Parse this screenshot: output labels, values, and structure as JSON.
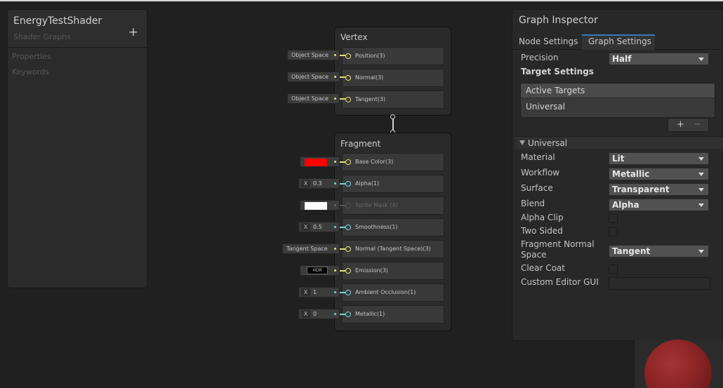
{
  "blackboard": {
    "title": "EnergyTestShader",
    "subtitle": "Shader Graphs",
    "add_icon": "+",
    "sections": [
      "Properties",
      "Keywords"
    ]
  },
  "vertex_node": {
    "title": "Vertex",
    "slots": [
      {
        "label": "Position(3)",
        "input": "Object Space"
      },
      {
        "label": "Normal(3)",
        "input": "Object Space"
      },
      {
        "label": "Tangent(3)",
        "input": "Object Space"
      }
    ]
  },
  "fragment_node": {
    "title": "Fragment",
    "slots": [
      {
        "label": "Base Color(3)",
        "input_type": "color",
        "input_color": "#ff0000"
      },
      {
        "label": "Alpha(1)",
        "input_type": "x",
        "x_label": "X",
        "value": "0.3"
      },
      {
        "label": "Sprite Mask (4)",
        "input_type": "color",
        "input_color": "#ffffff"
      },
      {
        "label": "Smoothness(1)",
        "input_type": "x",
        "x_label": "X",
        "value": "0.5"
      },
      {
        "label": "Normal (Tangent Space)(3)",
        "input_type": "text",
        "input": "Tangent Space"
      },
      {
        "label": "Emission(3)",
        "input_type": "hdr",
        "input": "HDR"
      },
      {
        "label": "Ambient Occlusion(1)",
        "input_type": "x",
        "x_label": "X",
        "value": "1"
      },
      {
        "label": "Metallic(1)",
        "input_type": "x",
        "x_label": "X",
        "value": "0"
      }
    ]
  },
  "inspector": {
    "title": "Graph Inspector",
    "tabs": [
      "Node Settings",
      "Graph Settings"
    ],
    "active_tab": "Graph Settings",
    "precision_label": "Precision",
    "precision_value": "Half",
    "target_settings_label": "Target Settings",
    "active_targets_header": "Active Targets",
    "active_targets": [
      "Universal"
    ],
    "add_icon": "+",
    "remove_icon": "−",
    "section": "Universal",
    "settings": {
      "material": {
        "label": "Material",
        "value": "Lit"
      },
      "workflow": {
        "label": "Workflow",
        "value": "Metallic"
      },
      "surface": {
        "label": "Surface",
        "value": "Transparent"
      },
      "blend": {
        "label": "Blend",
        "value": "Alpha"
      },
      "alpha_clip": {
        "label": "Alpha Clip",
        "checked": false
      },
      "two_sided": {
        "label": "Two Sided",
        "checked": false
      },
      "fragment_normal_space": {
        "label": "Fragment Normal Space",
        "value": "Tangent"
      },
      "clear_coat": {
        "label": "Clear Coat",
        "checked": false
      },
      "custom_editor_gui": {
        "label": "Custom Editor GUI",
        "value": ""
      }
    }
  },
  "colors": {
    "vector_port": "#e4e07a",
    "float_port": "#7ad3d8",
    "active_tab_accent": "#3a79bb"
  }
}
